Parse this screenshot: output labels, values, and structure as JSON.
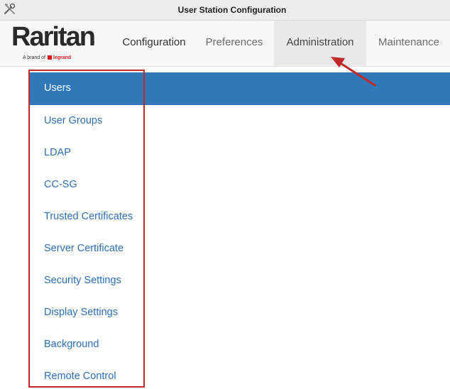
{
  "window": {
    "title": "User Station Configuration",
    "app_icon": "tools-icon"
  },
  "logo": {
    "word": "Raritan",
    "registered": "®",
    "tagline": "A brand of",
    "brand": "legrand"
  },
  "tabs": [
    {
      "label": "Configuration"
    },
    {
      "label": "Preferences"
    },
    {
      "label": "Administration",
      "active": true
    },
    {
      "label": "Maintenance"
    }
  ],
  "sidebar": {
    "items": [
      {
        "label": "Users",
        "selected": true
      },
      {
        "label": "User Groups"
      },
      {
        "label": "LDAP"
      },
      {
        "label": "CC-SG"
      },
      {
        "label": "Trusted Certificates"
      },
      {
        "label": "Server Certificate"
      },
      {
        "label": "Security Settings"
      },
      {
        "label": "Display Settings"
      },
      {
        "label": "Background"
      },
      {
        "label": "Remote Control"
      }
    ]
  },
  "colors": {
    "accent": "#3178b9",
    "link": "#2e6fb2",
    "annotation": "#c12a2a"
  }
}
